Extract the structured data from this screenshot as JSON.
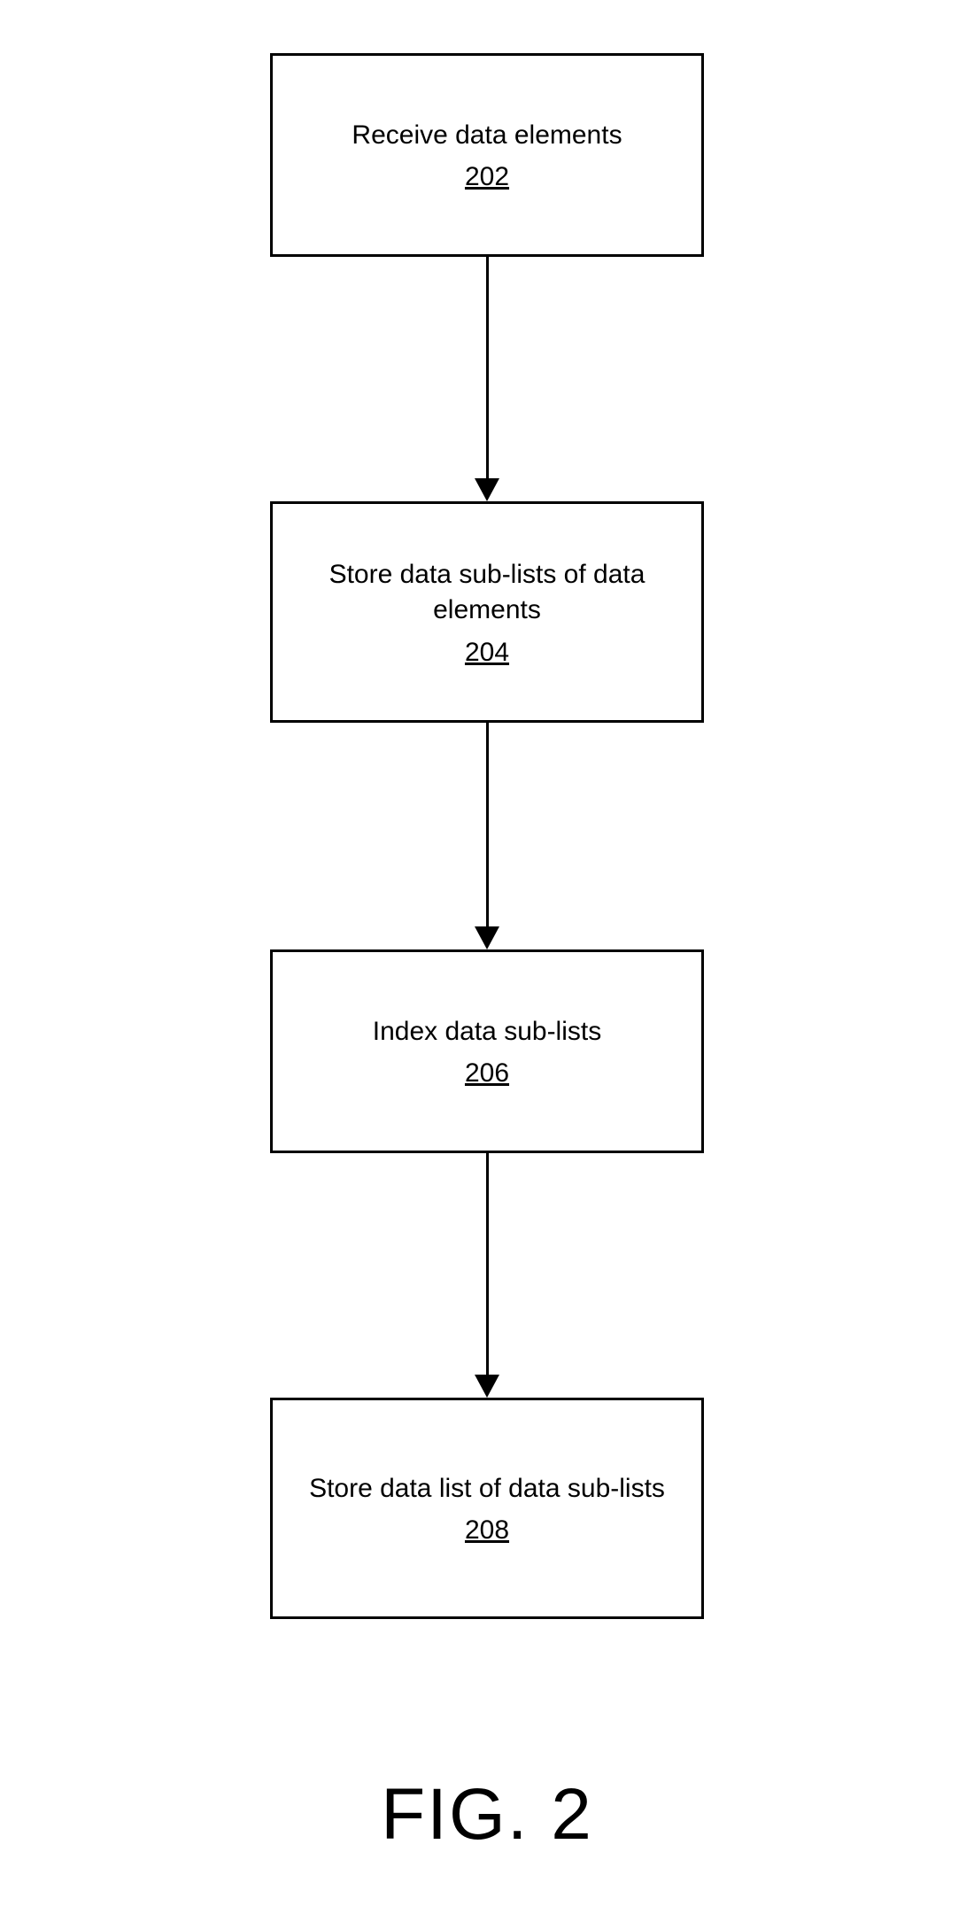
{
  "flowchart": {
    "steps": [
      {
        "text": "Receive data elements",
        "ref": "202"
      },
      {
        "text": "Store data sub-lists of data elements",
        "ref": "204"
      },
      {
        "text": "Index data sub-lists",
        "ref": "206"
      },
      {
        "text": "Store data list of data sub-lists",
        "ref": "208"
      }
    ]
  },
  "figure_label": "FIG. 2"
}
